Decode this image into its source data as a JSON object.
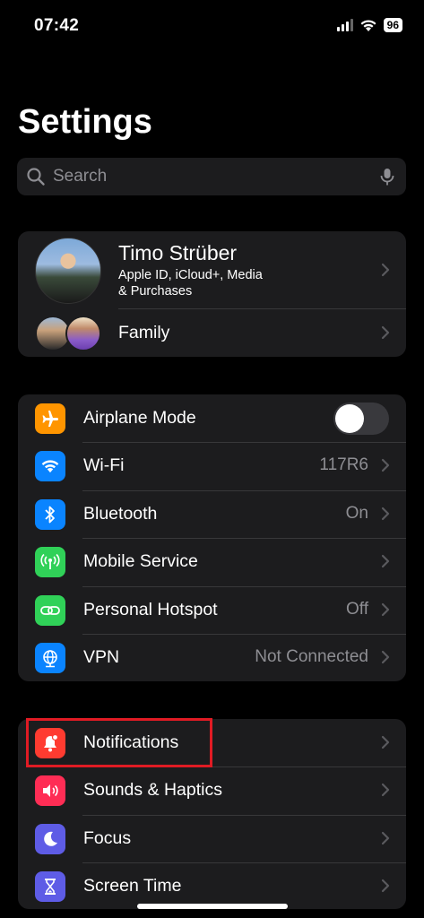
{
  "status_bar": {
    "time": "07:42",
    "battery": "96"
  },
  "page": {
    "title": "Settings"
  },
  "search": {
    "placeholder": "Search"
  },
  "profile": {
    "name": "Timo Strüber",
    "subtitle_line1": "Apple ID, iCloud+, Media",
    "subtitle_line2": "& Purchases",
    "family_label": "Family"
  },
  "connectivity": [
    {
      "label": "Airplane Mode",
      "value": "",
      "icon": "airplane-icon",
      "color": "#ff9500",
      "toggle": false
    },
    {
      "label": "Wi-Fi",
      "value": "117R6",
      "icon": "wifi-icon",
      "color": "#0a84ff"
    },
    {
      "label": "Bluetooth",
      "value": "On",
      "icon": "bluetooth-icon",
      "color": "#0a84ff"
    },
    {
      "label": "Mobile Service",
      "value": "",
      "icon": "antenna-icon",
      "color": "#30d158"
    },
    {
      "label": "Personal Hotspot",
      "value": "Off",
      "icon": "link-icon",
      "color": "#30d158"
    },
    {
      "label": "VPN",
      "value": "Not Connected",
      "icon": "globe-icon",
      "color": "#0a84ff"
    }
  ],
  "notifications_group": [
    {
      "label": "Notifications",
      "icon": "bell-icon",
      "color": "#ff3b30"
    },
    {
      "label": "Sounds & Haptics",
      "icon": "speaker-icon",
      "color": "#ff2d55"
    },
    {
      "label": "Focus",
      "icon": "moon-icon",
      "color": "#5e5ce6"
    },
    {
      "label": "Screen Time",
      "icon": "hourglass-icon",
      "color": "#5e5ce6"
    }
  ],
  "colors": {
    "highlight": "#e01b24",
    "background": "#000000",
    "cell": "#1c1c1e"
  }
}
